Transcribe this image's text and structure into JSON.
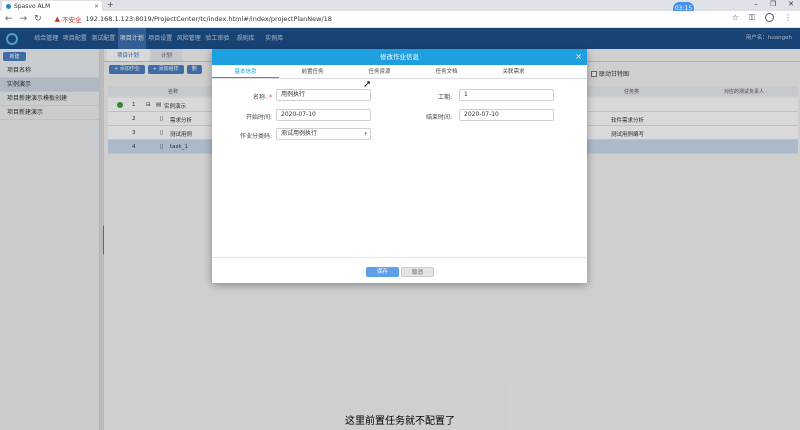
{
  "browser": {
    "tab_title": "Spasvo ALM",
    "tab_close": "×",
    "new_tab": "+",
    "insecure_label": "不安全",
    "url": "192.168.1.123:8019/ProjectCenter/tc/index.html#/index/projectPlanNew/18",
    "timer": "03:15",
    "window_controls": [
      "–",
      "❐",
      "✕"
    ],
    "addr_icons": [
      "☆",
      "⚿"
    ]
  },
  "app": {
    "menu": [
      "综合管理",
      "项目配置",
      "测试配置",
      "项目计划",
      "项目设置",
      "风险管理",
      "验工审验",
      "规则库",
      "实例库"
    ],
    "active_menu_index": 3,
    "user": "用户名：huangeh"
  },
  "sidebar": {
    "button": "新建",
    "items": [
      "项目名称",
      "实例演示",
      "项目新建演示模板创建",
      "项目新建演示"
    ],
    "active_index": 1
  },
  "main": {
    "tabs": [
      "项目计划",
      "计划"
    ],
    "toolbar": [
      "+ 添加作业",
      "+ 添加组样",
      "删"
    ],
    "linkage_label": "联动甘特图",
    "grid_headers": [
      "名称",
      "任务类",
      "对应的测试负责人"
    ],
    "rows": [
      {
        "num": "1",
        "name": "实例演示",
        "type": "",
        "owner": ""
      },
      {
        "num": "2",
        "name": "需求分析",
        "type": "",
        "owner": "软件需求分析"
      },
      {
        "num": "3",
        "name": "测试用例",
        "type": "",
        "owner": "测试用例编写"
      },
      {
        "num": "4",
        "name": "task_1",
        "type": "",
        "owner": ""
      }
    ]
  },
  "dialog": {
    "title": "修改作业信息",
    "close": "×",
    "tabs": [
      "基本信息",
      "前置任务",
      "任务资源",
      "任务文档",
      "关联需求"
    ],
    "active_tab_index": 0,
    "fields": {
      "name_label": "名称:",
      "name_required": "*",
      "name_value": "用例执行",
      "workdays_label": "工期:",
      "workdays_value": "1",
      "start_label": "开始时间:",
      "start_value": "2020-07-10",
      "end_label": "结束时间:",
      "end_value": "2020-07-10",
      "category_label": "作业分类码:",
      "category_value": "测试用例执行",
      "category_arrow": "▾"
    },
    "save_label": "保存",
    "cancel_label": "取消"
  },
  "subtitle": "这里前置任务就不配置了"
}
